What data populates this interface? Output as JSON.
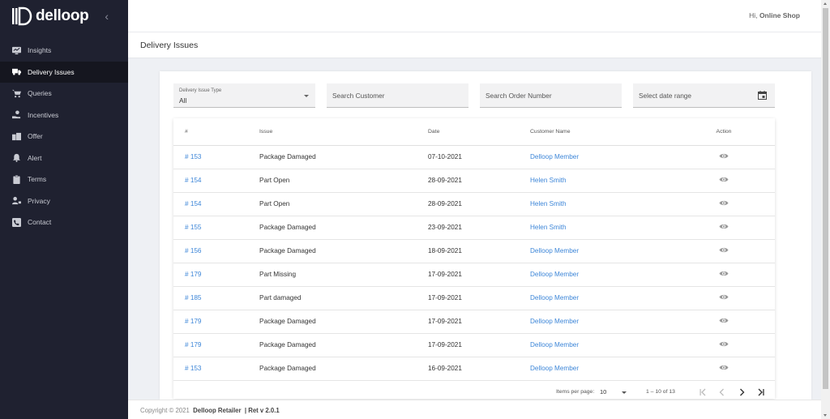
{
  "brand": {
    "name": "delloop"
  },
  "nav": [
    {
      "label": "Insights",
      "icon": "insights-icon",
      "active": false
    },
    {
      "label": "Delivery Issues",
      "icon": "truck-icon",
      "active": true
    },
    {
      "label": "Queries",
      "icon": "cart-icon",
      "active": false
    },
    {
      "label": "Incentives",
      "icon": "hand-coin-icon",
      "active": false
    },
    {
      "label": "Offer",
      "icon": "building-icon",
      "active": false
    },
    {
      "label": "Alert",
      "icon": "bell-icon",
      "active": false
    },
    {
      "label": "Terms",
      "icon": "clipboard-icon",
      "active": false
    },
    {
      "label": "Privacy",
      "icon": "user-lock-icon",
      "active": false
    },
    {
      "label": "Contact",
      "icon": "phone-icon",
      "active": false
    }
  ],
  "header": {
    "greeting": "Hi,",
    "user": "Online Shop"
  },
  "page": {
    "title": "Delivery Issues"
  },
  "filters": {
    "issue_type_label": "Delivery Issue Type",
    "issue_type_value": "All",
    "customer_placeholder": "Search Customer",
    "order_placeholder": "Search Order Number",
    "date_placeholder": "Select date range"
  },
  "table": {
    "headers": [
      "#",
      "Issue",
      "Date",
      "Customer Name",
      "Action"
    ],
    "rows": [
      {
        "id": "# 153",
        "issue": "Package Damaged",
        "date": "07-10-2021",
        "customer": "Delloop Member"
      },
      {
        "id": "# 154",
        "issue": "Part Open",
        "date": "28-09-2021",
        "customer": "Helen Smith"
      },
      {
        "id": "# 154",
        "issue": "Part Open",
        "date": "28-09-2021",
        "customer": "Helen Smith"
      },
      {
        "id": "# 155",
        "issue": "Package Damaged",
        "date": "23-09-2021",
        "customer": "Helen Smith"
      },
      {
        "id": "# 156",
        "issue": "Package Damaged",
        "date": "18-09-2021",
        "customer": "Delloop Member"
      },
      {
        "id": "# 179",
        "issue": "Part Missing",
        "date": "17-09-2021",
        "customer": "Delloop Member"
      },
      {
        "id": "# 185",
        "issue": "Part damaged",
        "date": "17-09-2021",
        "customer": "Delloop Member"
      },
      {
        "id": "# 179",
        "issue": "Package Damaged",
        "date": "17-09-2021",
        "customer": "Delloop Member"
      },
      {
        "id": "# 179",
        "issue": "Package Damaged",
        "date": "17-09-2021",
        "customer": "Delloop Member"
      },
      {
        "id": "# 153",
        "issue": "Package Damaged",
        "date": "16-09-2021",
        "customer": "Delloop Member"
      }
    ]
  },
  "pagination": {
    "items_per_page_label": "Items per page:",
    "page_size": "10",
    "range": "1 – 10 of 13"
  },
  "footer": {
    "copyright": "Copyright © 2021",
    "company": "Delloop Retailer",
    "version": "| Ret v 2.0.1"
  },
  "colors": {
    "sidebar": "#1f2130",
    "link": "#3d86d8",
    "background": "#eef0f4"
  }
}
